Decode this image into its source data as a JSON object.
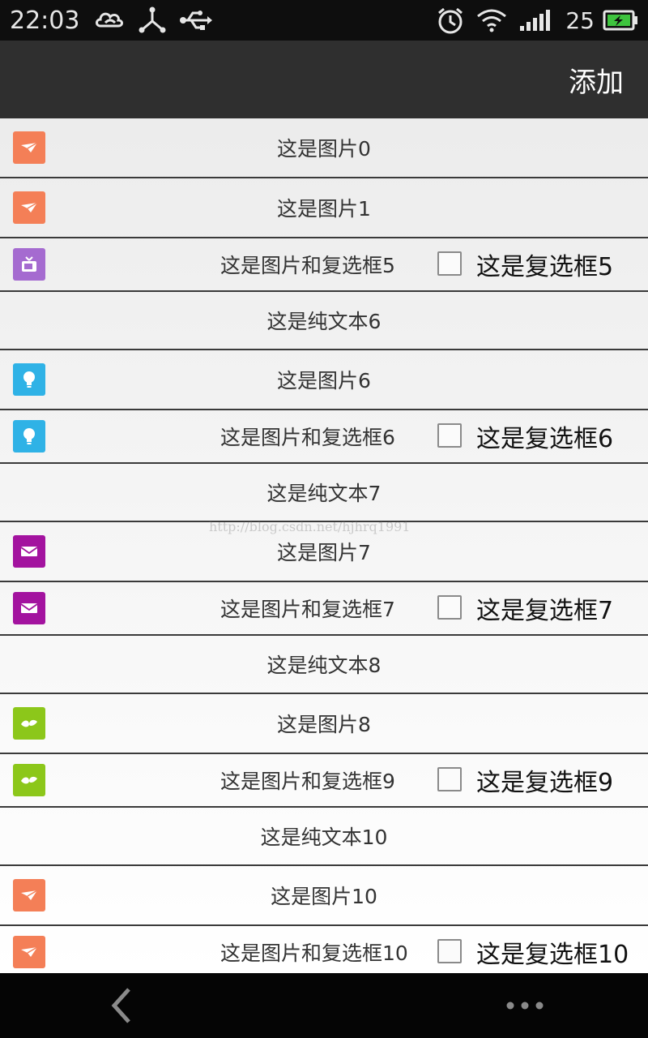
{
  "status_bar": {
    "time": "22:03",
    "battery_level": "25",
    "icons": [
      "cloud-icon",
      "share-network-icon",
      "usb-icon",
      "alarm-icon",
      "wifi-icon",
      "signal-icon",
      "battery-icon"
    ]
  },
  "action_bar": {
    "add_label": "添加"
  },
  "watermark": "http://blog.csdn.net/hjhrq1991",
  "list": [
    {
      "type": "image",
      "text": "这是图片0",
      "icon": "paper-plane-icon",
      "color": "#f47f57"
    },
    {
      "type": "image",
      "text": "这是图片1",
      "icon": "paper-plane-icon",
      "color": "#f47f57"
    },
    {
      "type": "image_checkbox",
      "text": "这是图片和复选框5",
      "checkbox_text": "这是复选框5",
      "icon": "tv-icon",
      "color": "#a56bd0"
    },
    {
      "type": "text",
      "text": "这是纯文本6"
    },
    {
      "type": "image",
      "text": "这是图片6",
      "icon": "lightbulb-icon",
      "color": "#2fb2e6"
    },
    {
      "type": "image_checkbox",
      "text": "这是图片和复选框6",
      "checkbox_text": "这是复选框6",
      "icon": "lightbulb-icon",
      "color": "#2fb2e6"
    },
    {
      "type": "text",
      "text": "这是纯文本7"
    },
    {
      "type": "image",
      "text": "这是图片7",
      "icon": "mail-icon",
      "color": "#a3139f"
    },
    {
      "type": "image_checkbox",
      "text": "这是图片和复选框7",
      "checkbox_text": "这是复选框7",
      "icon": "mail-icon",
      "color": "#a3139f"
    },
    {
      "type": "text",
      "text": "这是纯文本8"
    },
    {
      "type": "image",
      "text": "这是图片8",
      "icon": "leaf-icon",
      "color": "#8cc71a"
    },
    {
      "type": "image_checkbox",
      "text": "这是图片和复选框9",
      "checkbox_text": "这是复选框9",
      "icon": "leaf-icon",
      "color": "#8cc71a"
    },
    {
      "type": "text",
      "text": "这是纯文本10"
    },
    {
      "type": "image",
      "text": "这是图片10",
      "icon": "paper-plane-icon",
      "color": "#f47f57"
    },
    {
      "type": "image_checkbox",
      "text": "这是图片和复选框10",
      "checkbox_text": "这是复选框10",
      "icon": "paper-plane-icon",
      "color": "#f47f57"
    }
  ]
}
